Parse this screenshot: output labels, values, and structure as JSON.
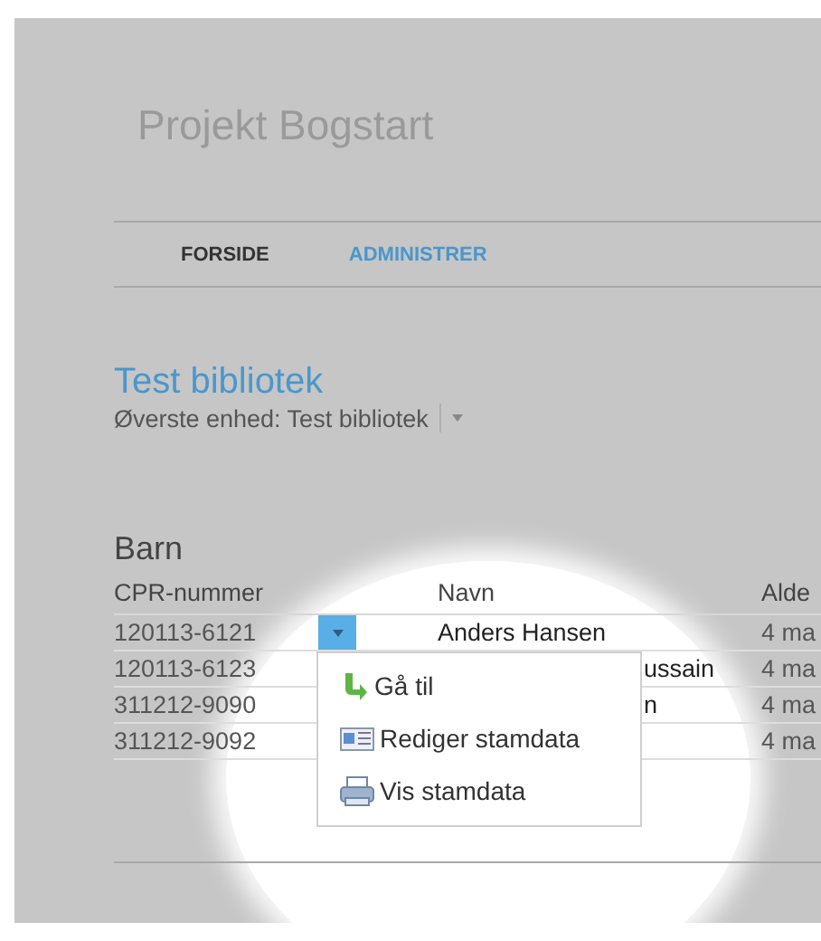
{
  "site_title": "Projekt Bogstart",
  "nav": [
    {
      "label": "FORSIDE",
      "selected": false
    },
    {
      "label": "ADMINISTRER",
      "selected": true
    }
  ],
  "heading": "Test bibliotek",
  "unit_selector": {
    "label": "Øverste enhed: Test bibliotek"
  },
  "section_title": "Barn",
  "table": {
    "columns": [
      "CPR-nummer",
      "Navn",
      "Alde"
    ],
    "rows": [
      {
        "cpr": "120113-6121",
        "name": "Anders Hansen",
        "age": "4 ma",
        "menu_open": true
      },
      {
        "cpr": "120113-6123",
        "name": "ussain",
        "age": "4 ma",
        "menu_open": false
      },
      {
        "cpr": "311212-9090",
        "name": "n",
        "age": "4 ma",
        "menu_open": false
      },
      {
        "cpr": "311212-9092",
        "age": "4 ma",
        "menu_open": false
      }
    ]
  },
  "row_menu": [
    {
      "kind": "goto",
      "label": "Gå til"
    },
    {
      "kind": "edit",
      "label": "Rediger stamdata"
    },
    {
      "kind": "print",
      "label": "Vis stamdata"
    }
  ]
}
